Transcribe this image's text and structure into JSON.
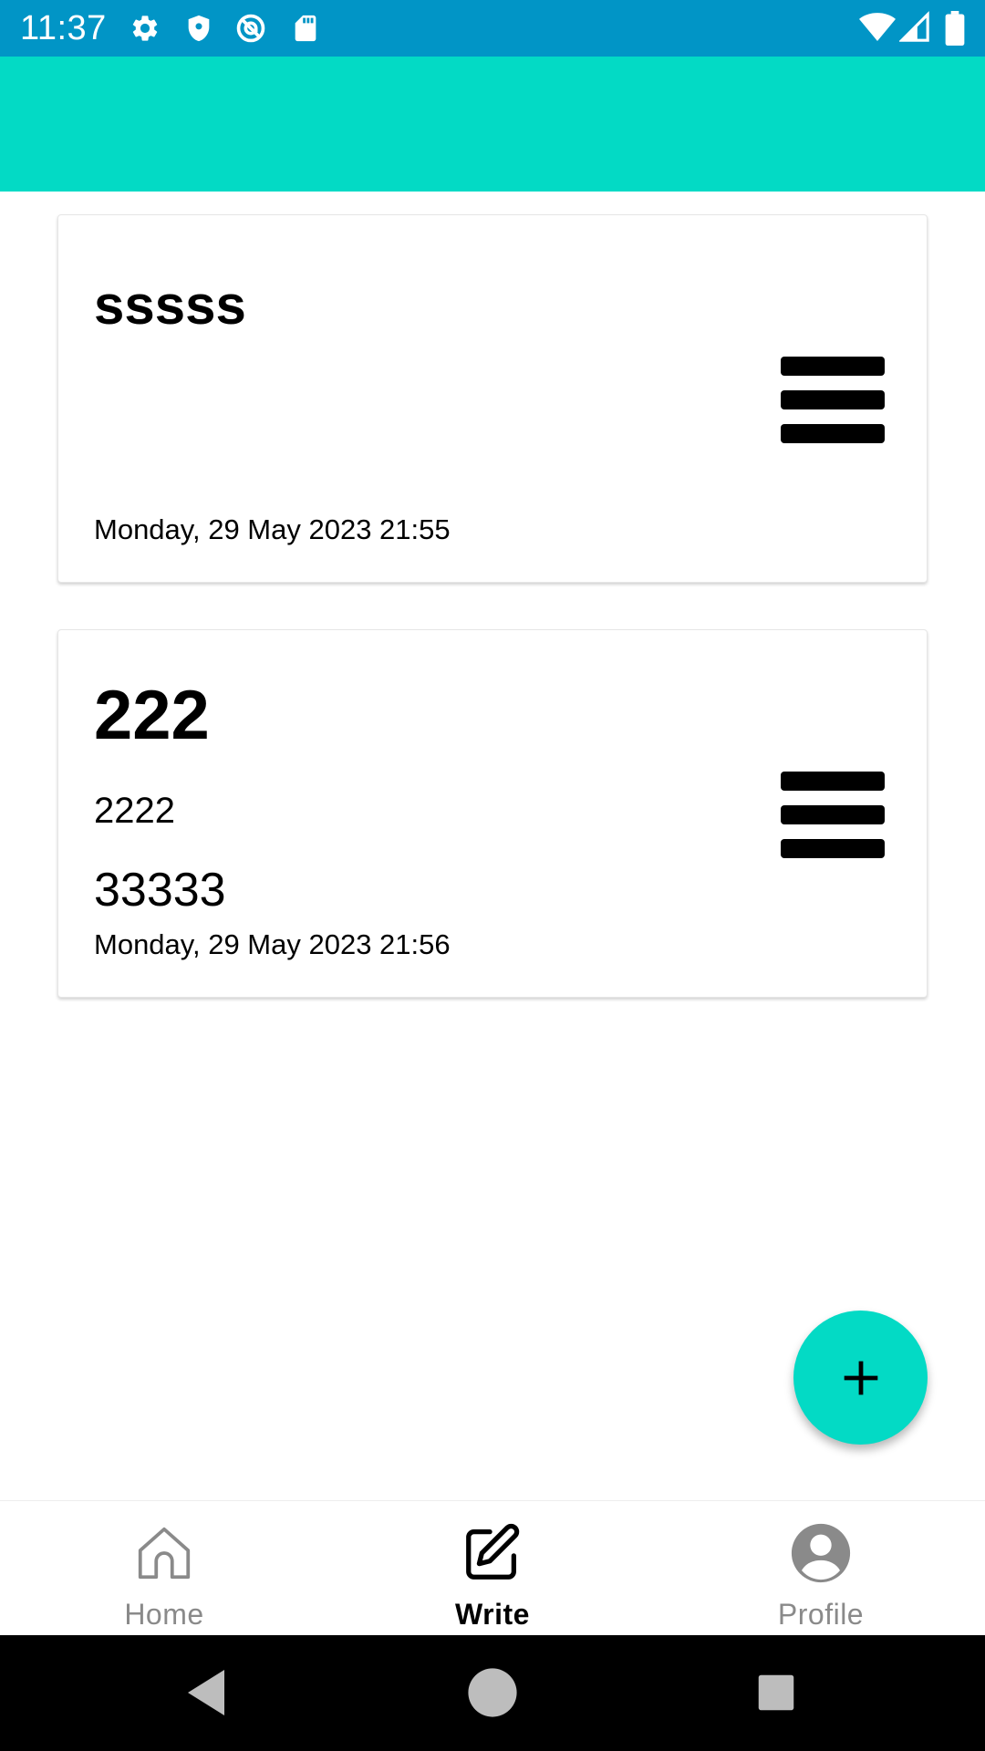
{
  "status_bar": {
    "time": "11:37",
    "icons": [
      "settings-icon",
      "shield-icon",
      "at-sign-icon",
      "sd-card-icon",
      "wifi-icon",
      "cell-signal-icon",
      "battery-icon"
    ],
    "background": "#0195c6"
  },
  "app_bar": {
    "background": "#03dac5"
  },
  "notes": [
    {
      "title": "sssss",
      "body": "",
      "extra": "",
      "date": "Monday, 29 May 2023 21:55",
      "menu_icon": "hamburger-menu-icon"
    },
    {
      "title": "222",
      "body": "2222",
      "extra": "33333",
      "date": "Monday, 29 May 2023 21:56",
      "menu_icon": "hamburger-menu-icon"
    }
  ],
  "fab": {
    "icon": "plus-icon",
    "color": "#03dac5"
  },
  "bottom_nav": {
    "items": [
      {
        "label": "Home",
        "icon": "home-icon",
        "active": false
      },
      {
        "label": "Write",
        "icon": "pencil-square-icon",
        "active": true
      },
      {
        "label": "Profile",
        "icon": "account-circle-icon",
        "active": false
      }
    ],
    "active_color": "#000000",
    "inactive_color": "#8a8a8a"
  },
  "system_nav": {
    "icons": [
      "back-icon",
      "home-circle-icon",
      "recents-icon"
    ]
  }
}
